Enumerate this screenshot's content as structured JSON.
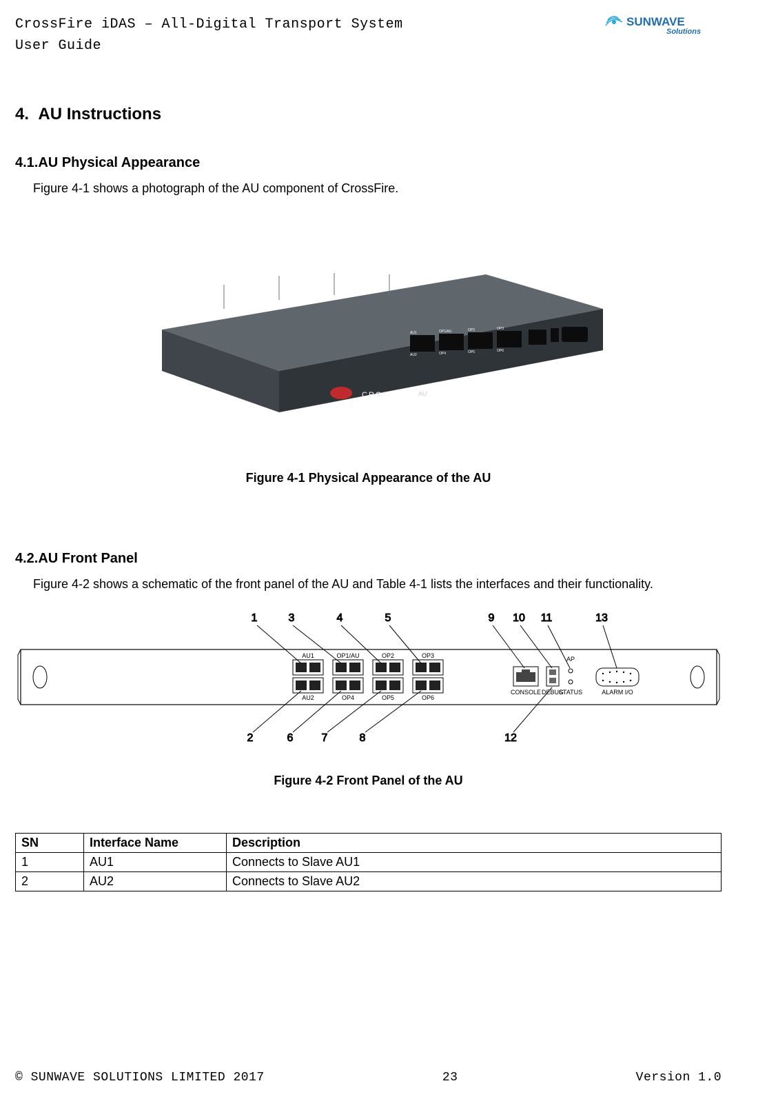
{
  "header": {
    "title_line1": "CrossFire iDAS – All-Digital Transport System",
    "title_line2": "User Guide",
    "logo_main": "SUNWAVE",
    "logo_sub": "Solutions"
  },
  "sections": {
    "h1_number": "4.",
    "h1_title": "AU Instructions",
    "h2_1_number": "4.1.",
    "h2_1_title": "AU Physical Appearance",
    "p1": "Figure 4-1 shows a photograph of the AU component of CrossFire.",
    "fig1_caption": "Figure 4-1 Physical Appearance of the AU",
    "h2_2_number": "4.2.",
    "h2_2_title": "AU Front Panel",
    "p2": "Figure 4-2 shows a schematic of the front panel of the AU and Table 4-1 lists the interfaces and their functionality.",
    "fig2_caption": "Figure 4-2 Front Panel of the AU"
  },
  "device": {
    "brand_on_device": "CROSSFIRE",
    "model_label": "AU",
    "rear_ports": {
      "top_row": [
        "AU1",
        "OP1/AU",
        "OP2",
        "OP3"
      ],
      "bottom_row": [
        "AU2",
        "OP4",
        "OP5",
        "OP6"
      ],
      "right_block": [
        "CONSOLE",
        "DEBUG",
        "STATUS"
      ],
      "ap_label": "AP",
      "alarm_label": "ALARM I/O"
    }
  },
  "front_panel_diagram": {
    "top_callouts": [
      "1",
      "3",
      "4",
      "5",
      "9",
      "10",
      "11",
      "13"
    ],
    "bottom_callouts": [
      "2",
      "6",
      "7",
      "8",
      "12"
    ],
    "port_labels_top": [
      "AU1",
      "OP1/AU",
      "OP2",
      "OP3"
    ],
    "port_labels_bottom": [
      "AU2",
      "OP4",
      "OP5",
      "OP6"
    ],
    "right_labels": [
      "CONSOLE",
      "DEBUG",
      "STATUS"
    ],
    "ap_label": "AP",
    "alarm_label": "ALARM I/O"
  },
  "table": {
    "headers": [
      "SN",
      "Interface Name",
      "Description"
    ],
    "rows": [
      [
        "1",
        "AU1",
        "Connects to Slave AU1"
      ],
      [
        "2",
        "AU2",
        "Connects to Slave AU2"
      ]
    ]
  },
  "footer": {
    "left": "© SUNWAVE SOLUTIONS LIMITED 2017",
    "center": "23",
    "right": "Version 1.0"
  }
}
